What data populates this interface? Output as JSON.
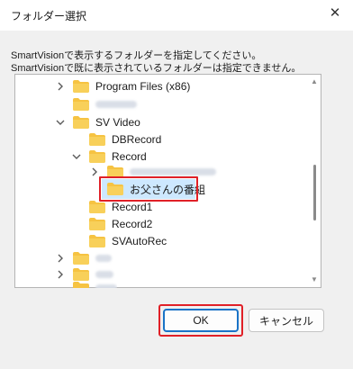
{
  "window": {
    "title": "フォルダー選択"
  },
  "instructions": {
    "line1": "SmartVisionで表示するフォルダーを指定してください。",
    "line2": "SmartVisionで既に表示されているフォルダーは指定できません。"
  },
  "tree": {
    "items": [
      {
        "label": "Program Files (x86)",
        "expanded": false
      },
      {
        "label": "",
        "redacted": true,
        "expanded": null
      },
      {
        "label": "SV Video",
        "expanded": true
      },
      {
        "label": "DBRecord",
        "expanded": null
      },
      {
        "label": "Record",
        "expanded": true
      },
      {
        "label": "",
        "redacted": true,
        "expanded": false
      },
      {
        "label": "お父さんの番組",
        "selected": true,
        "expanded": null
      },
      {
        "label": "Record1",
        "expanded": null
      },
      {
        "label": "Record2",
        "expanded": null
      },
      {
        "label": "SVAutoRec",
        "expanded": null
      },
      {
        "label": "",
        "redacted": true,
        "expanded": false
      },
      {
        "label": "",
        "redacted": true,
        "expanded": false
      },
      {
        "label": "",
        "redacted": true,
        "expanded": null
      }
    ]
  },
  "buttons": {
    "ok": "OK",
    "cancel": "キャンセル"
  },
  "colors": {
    "folder": "#f6c342",
    "folder_dark": "#e8a91f",
    "highlight": "#e02027",
    "selection": "#cde8ff",
    "accent": "#1a73c7"
  },
  "icons": {
    "close": "close-icon",
    "folder": "folder-icon",
    "chevron_right": "chevron-right-icon",
    "chevron_down": "chevron-down-icon"
  }
}
